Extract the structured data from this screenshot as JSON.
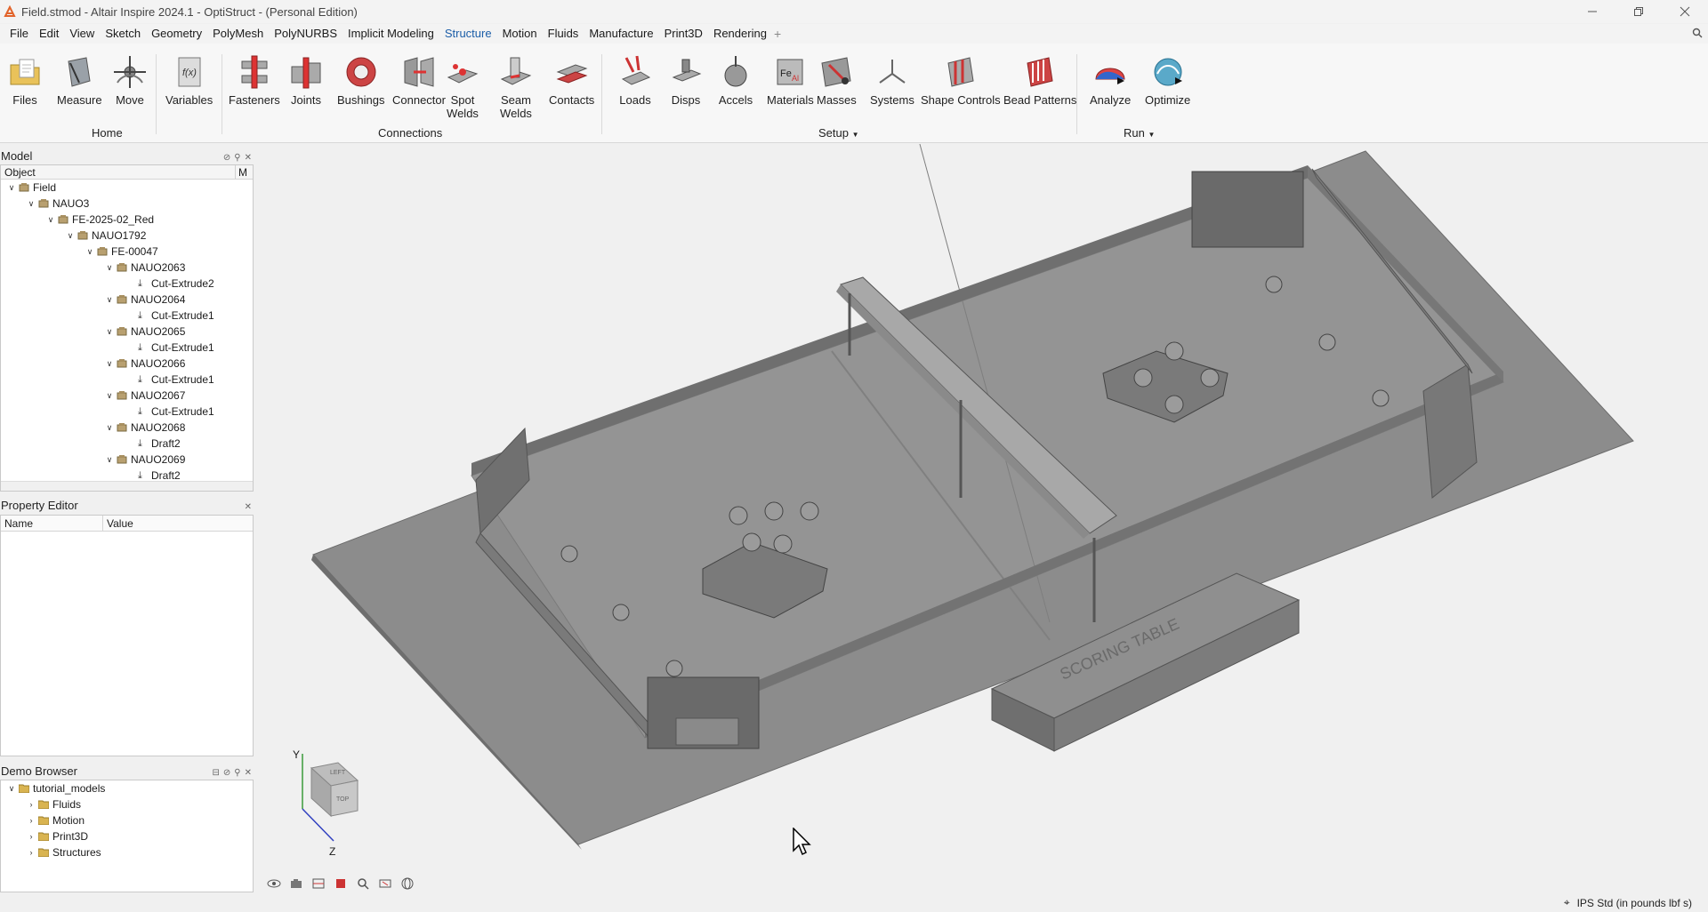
{
  "window": {
    "title": "Field.stmod - Altair Inspire 2024.1 - OptiStruct - (Personal Edition)"
  },
  "menu": {
    "items": [
      "File",
      "Edit",
      "View",
      "Sketch",
      "Geometry",
      "PolyMesh",
      "PolyNURBS",
      "Implicit Modeling",
      "Structure",
      "Motion",
      "Fluids",
      "Manufacture",
      "Print3D",
      "Rendering"
    ],
    "active": "Structure",
    "plus": "+"
  },
  "ribbon": {
    "tools": {
      "files": "Files",
      "measure": "Measure",
      "move": "Move",
      "variables": "Variables",
      "fasteners": "Fasteners",
      "joints": "Joints",
      "bushings": "Bushings",
      "connectors": "Connector",
      "spot_welds": "Spot\nWelds",
      "seam_welds": "Seam\nWelds",
      "contacts": "Contacts",
      "loads": "Loads",
      "disps": "Disps",
      "accels": "Accels",
      "materials": "Materials",
      "masses": "Masses",
      "systems": "Systems",
      "shape_controls": "Shape Controls",
      "bead_patterns": "Bead Patterns",
      "analyze": "Analyze",
      "optimize": "Optimize"
    },
    "groups": {
      "home": "Home",
      "connections": "Connections",
      "setup": "Setup",
      "run": "Run"
    }
  },
  "model_browser": {
    "title": "Model",
    "col_object": "Object",
    "col_m": "M",
    "rows": [
      {
        "label": "Field"
      },
      {
        "label": "NAUO3"
      },
      {
        "label": "FE-2025-02_Red"
      },
      {
        "label": "NAUO1792"
      },
      {
        "label": "FE-00047"
      },
      {
        "label": "NAUO2063"
      },
      {
        "label": "Cut-Extrude2"
      },
      {
        "label": "NAUO2064"
      },
      {
        "label": "Cut-Extrude1"
      },
      {
        "label": "NAUO2065"
      },
      {
        "label": "Cut-Extrude1"
      },
      {
        "label": "NAUO2066"
      },
      {
        "label": "Cut-Extrude1"
      },
      {
        "label": "NAUO2067"
      },
      {
        "label": "Cut-Extrude1"
      },
      {
        "label": "NAUO2068"
      },
      {
        "label": "Draft2"
      },
      {
        "label": "NAUO2069"
      },
      {
        "label": "Draft2"
      }
    ]
  },
  "property_editor": {
    "title": "Property Editor",
    "col_name": "Name",
    "col_value": "Value"
  },
  "demo_browser": {
    "title": "Demo Browser",
    "rows": [
      {
        "label": "tutorial_models"
      },
      {
        "label": "Fluids"
      },
      {
        "label": "Motion"
      },
      {
        "label": "Print3D"
      },
      {
        "label": "Structures"
      }
    ]
  },
  "viewport": {
    "scoring_table_text": "SCORING TABLE",
    "axis_y": "Y",
    "axis_z": "Z",
    "cube_left": "LEFT",
    "cube_top": "TOP"
  },
  "status": {
    "units": "IPS Std (in pounds lbf s)"
  }
}
